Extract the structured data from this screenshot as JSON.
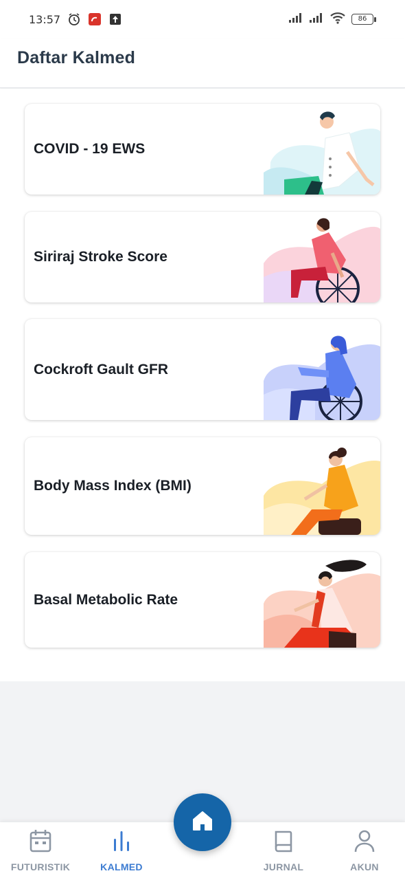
{
  "status_bar": {
    "time": "13:57",
    "battery": "86",
    "icons": [
      "alarm-icon",
      "app-notification-icon",
      "upload-icon",
      "signal-icon",
      "signal-icon",
      "wifi-icon",
      "battery-icon"
    ]
  },
  "app_bar": {
    "title": "Daftar Kalmed"
  },
  "cards": [
    {
      "label": "COVID - 19 EWS",
      "accent": "#2dbf8a"
    },
    {
      "label": "Siriraj Stroke Score",
      "accent": "#f06070"
    },
    {
      "label": "Cockroft Gault GFR",
      "accent": "#5b7ff0"
    },
    {
      "label": "Body Mass Index (BMI)",
      "accent": "#f7a21b"
    },
    {
      "label": "Basal Metabolic Rate",
      "accent": "#f2542d"
    }
  ],
  "bottom_nav": {
    "items": [
      {
        "label": "FUTURISTIK",
        "icon": "calendar-icon"
      },
      {
        "label": "KALMED",
        "icon": "bar-chart-icon"
      },
      {
        "label": "JURNAL",
        "icon": "book-icon"
      },
      {
        "label": "AKUN",
        "icon": "user-icon"
      }
    ],
    "center": {
      "icon": "home-icon"
    },
    "active_color": "#3b7bd1",
    "inactive_color": "#8c96a3"
  }
}
